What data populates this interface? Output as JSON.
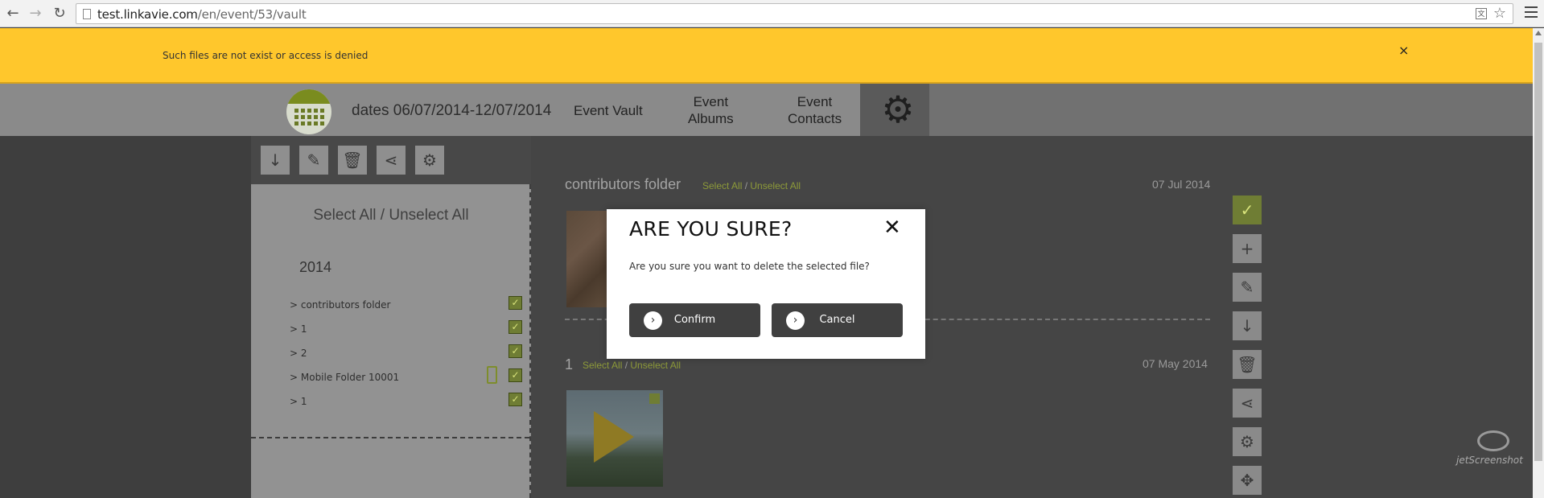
{
  "browser": {
    "back_icon": "arrow-left-icon",
    "forward_icon": "arrow-right-icon",
    "reload_icon": "reload-icon",
    "url_host": "test.linkavie.com",
    "url_path": "/en/event/53/vault"
  },
  "notification": {
    "message": "Such files are not exist or access is denied",
    "close": "×"
  },
  "header": {
    "dates": "dates 06/07/2014-12/07/2014",
    "nav": {
      "vault": "Event Vault",
      "albums_1": "Event",
      "albums_2": "Albums",
      "contacts_1": "Event",
      "contacts_2": "Contacts"
    }
  },
  "sidebar": {
    "select_all": "Select All / Unselect All",
    "year": "2014",
    "items": [
      {
        "label": "> contributors folder"
      },
      {
        "label": "> 1"
      },
      {
        "label": "> 2"
      },
      {
        "label": "> Mobile Folder 10001"
      },
      {
        "label": "> 1"
      }
    ]
  },
  "main": {
    "sections": [
      {
        "title": "contributors folder",
        "select_all": "Select All",
        "unselect_all": "Unselect All",
        "date": "07 Jul 2014"
      },
      {
        "title": "1",
        "select_all": "Select All",
        "unselect_all": "Unselect All",
        "date": "07 May 2014"
      }
    ],
    "separator": "/"
  },
  "modal": {
    "title": "ARE YOU SURE?",
    "message": "Are you sure you want to delete the selected file?",
    "confirm": "Confirm",
    "cancel": "Cancel"
  },
  "watermark": "jetScreenshot",
  "colors": {
    "notification": "#ffc72c",
    "accent_green": "#6f7d34",
    "modal_button": "#404040"
  }
}
